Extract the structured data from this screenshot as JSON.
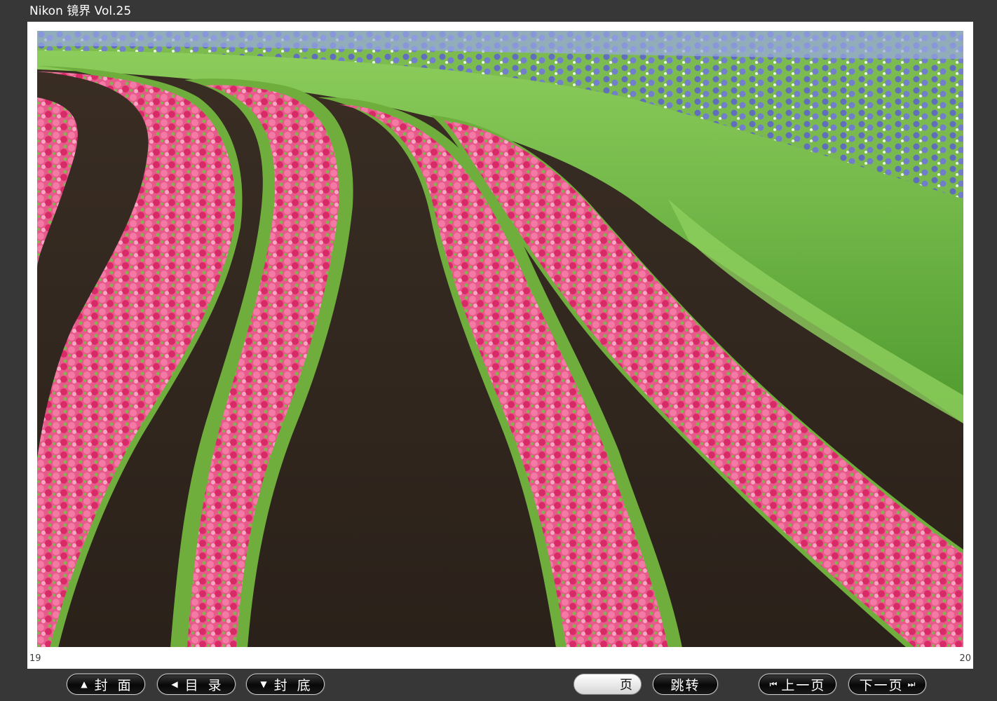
{
  "window": {
    "title": "Nikon 镜界 Vol.25"
  },
  "viewer": {
    "page_left": "19",
    "page_right": "20"
  },
  "nav": {
    "cover_glyph": "▲",
    "cover_label": "封面",
    "toc_glyph": "◀",
    "toc_label": "目录",
    "back_glyph": "▼",
    "back_label": "封底",
    "page_suffix": "页",
    "page_value": "",
    "jump_label": "跳转",
    "prev_glyph": "⏮",
    "prev_label": "上一页",
    "next_label": "下一页",
    "next_glyph": "⏭"
  },
  "colors": {
    "background": "#373737",
    "page": "#ffffff",
    "soil": "#2e241d",
    "flower_pink": "#e8407a",
    "foliage_green": "#6fae3d",
    "cornflower_blue": "#5a5fd0"
  },
  "icons": {
    "cover": "triangle-up-icon",
    "toc": "triangle-left-icon",
    "back": "triangle-down-icon",
    "prev": "skip-back-icon",
    "next": "skip-forward-icon"
  }
}
